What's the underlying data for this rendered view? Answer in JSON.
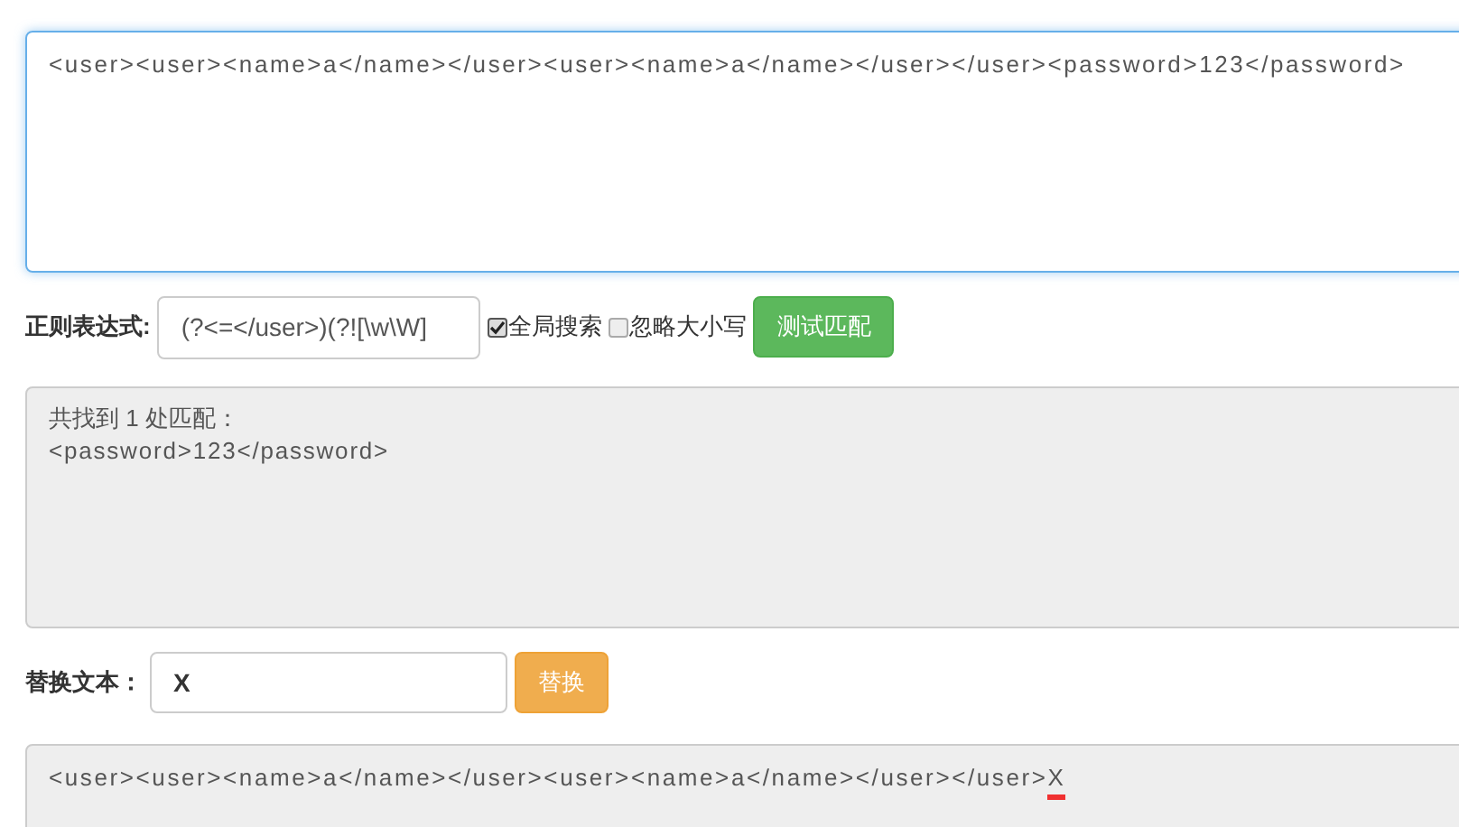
{
  "source": {
    "value": "<user><user><name>a</name></user><user><name>a</name></user></user><password>123</password>"
  },
  "regex": {
    "label": "正则表达式:",
    "value": "(?<=</user>)(?![\\w\\W]"
  },
  "options": [
    {
      "label": "全局搜索",
      "checked": true
    },
    {
      "label": "忽略大小写",
      "checked": false
    }
  ],
  "test_button": "测试匹配",
  "match_result": {
    "summary": "共找到 1 处匹配：",
    "lines": [
      "<password>123</password>"
    ]
  },
  "replace": {
    "label": "替换文本：",
    "value": "X",
    "button": "替换"
  },
  "replace_result": {
    "segments": [
      {
        "text": "<user><user><name>a</name></user><user><name>a</name></user></user>",
        "highlighted": false
      },
      {
        "text": "X",
        "highlighted": true
      }
    ]
  }
}
